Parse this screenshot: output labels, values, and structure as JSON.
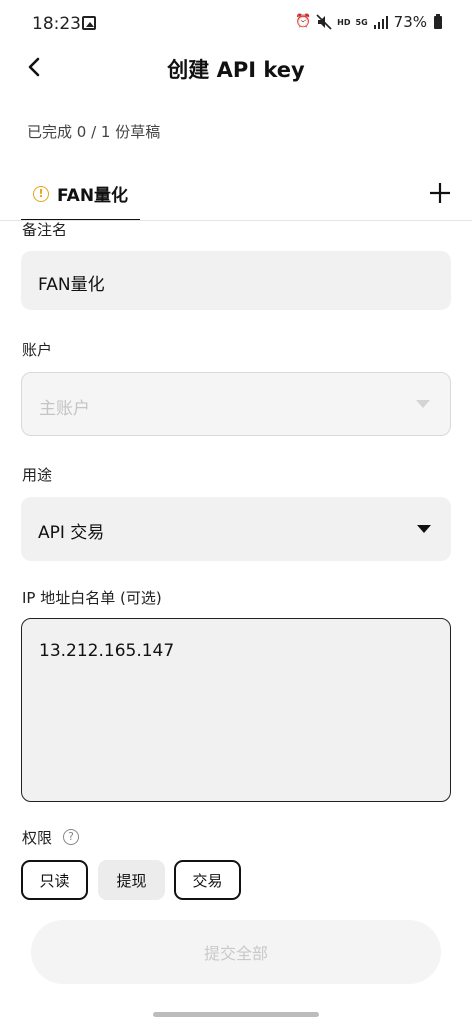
{
  "status_bar": {
    "time": "18:23",
    "network": "HD",
    "signal_type": "5G",
    "battery": "73%",
    "icons": [
      "gallery-icon",
      "alarm-icon",
      "mute-icon",
      "hd-icon",
      "5g-icon",
      "signal-icon",
      "battery-icon"
    ]
  },
  "header": {
    "title": "创建 API key",
    "back_icon": "chevron-left-icon"
  },
  "draft_status": "已完成 0 / 1 份草稿",
  "tabs": {
    "items": [
      {
        "label": "FAN量化",
        "icon": "warning-circle-icon",
        "icon_glyph": "!",
        "active": true
      }
    ],
    "add_icon": "plus-icon"
  },
  "form": {
    "remark": {
      "label": "备注名",
      "value": "FAN量化"
    },
    "account": {
      "label": "账户",
      "value": "主账户",
      "disabled": true
    },
    "usage": {
      "label": "用途",
      "value": "API 交易"
    },
    "ip_whitelist": {
      "label": "IP 地址白名单 (可选)",
      "value": "13.212.165.147"
    },
    "permissions": {
      "label": "权限",
      "help_icon": "question-circle-icon",
      "help_glyph": "?",
      "options": [
        {
          "label": "只读",
          "selected": true
        },
        {
          "label": "提现",
          "selected": false
        },
        {
          "label": "交易",
          "selected": true
        }
      ]
    }
  },
  "submit_button": {
    "label": "提交全部",
    "enabled": false
  },
  "colors": {
    "warning": "#e8a317",
    "field_bg": "#f1f1f1",
    "disabled_text": "#c4c4c4",
    "primary_text": "#111111"
  }
}
